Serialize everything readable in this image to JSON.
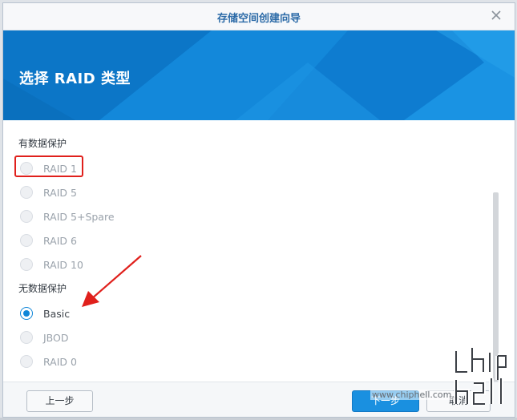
{
  "window": {
    "title": "存储空间创建向导",
    "close_icon": "close-icon"
  },
  "banner": {
    "heading": "选择 RAID 类型",
    "color": "#0f7fd2"
  },
  "groups": {
    "protected_label": "有数据保护",
    "unprotected_label": "无数据保护"
  },
  "options": {
    "raid1": {
      "label": "RAID 1",
      "checked": false,
      "enabled": false
    },
    "raid5": {
      "label": "RAID 5",
      "checked": false,
      "enabled": false
    },
    "raid5spare": {
      "label": "RAID 5+Spare",
      "checked": false,
      "enabled": false
    },
    "raid6": {
      "label": "RAID 6",
      "checked": false,
      "enabled": false
    },
    "raid10": {
      "label": "RAID 10",
      "checked": false,
      "enabled": false
    },
    "basic": {
      "label": "Basic",
      "checked": true,
      "enabled": true
    },
    "jbod": {
      "label": "JBOD",
      "checked": false,
      "enabled": false
    },
    "raid0": {
      "label": "RAID 0",
      "checked": false,
      "enabled": false
    }
  },
  "footer": {
    "back_label": "上一步",
    "next_label": "下一步",
    "cancel_label": "取消"
  },
  "watermark": {
    "url": "www.chiphell.com",
    "logo": "chip hell"
  },
  "annotation": {
    "highlight_color": "#e0201c",
    "arrow_color": "#e0201c"
  }
}
